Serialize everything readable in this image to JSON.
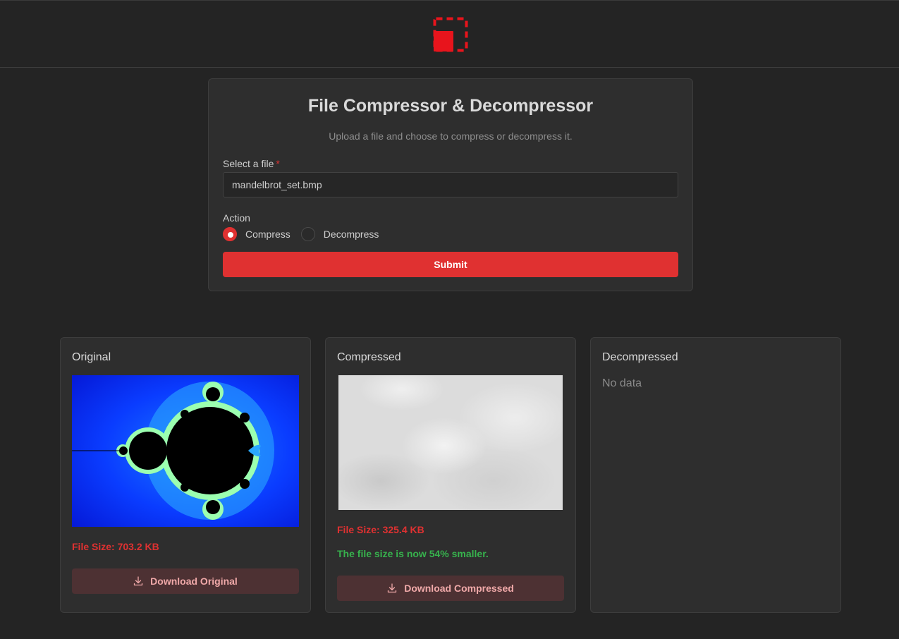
{
  "colors": {
    "accent": "#e03131",
    "success": "#37b24d",
    "background": "#242424",
    "card": "#2e2e2e"
  },
  "header": {
    "logo_icon": "resize-square-icon"
  },
  "form": {
    "title": "File Compressor & Decompressor",
    "subtitle": "Upload a file and choose to compress or decompress it.",
    "file_label": "Select a file",
    "required_mark": "*",
    "file_value": "mandelbrot_set.bmp",
    "action_label": "Action",
    "options": [
      {
        "label": "Compress",
        "selected": true
      },
      {
        "label": "Decompress",
        "selected": false
      }
    ],
    "submit_label": "Submit"
  },
  "panels": {
    "original": {
      "title": "Original",
      "image": "mandelbrot-image",
      "file_size": "File Size: 703.2 KB",
      "download_label": "Download Original",
      "download_icon": "download-icon"
    },
    "compressed": {
      "title": "Compressed",
      "image": "compressed-image-preview",
      "file_size": "File Size: 325.4 KB",
      "savings": "The file size is now 54% smaller.",
      "download_label": "Download Compressed",
      "download_icon": "download-icon"
    },
    "decompressed": {
      "title": "Decompressed",
      "empty_text": "No data"
    }
  }
}
